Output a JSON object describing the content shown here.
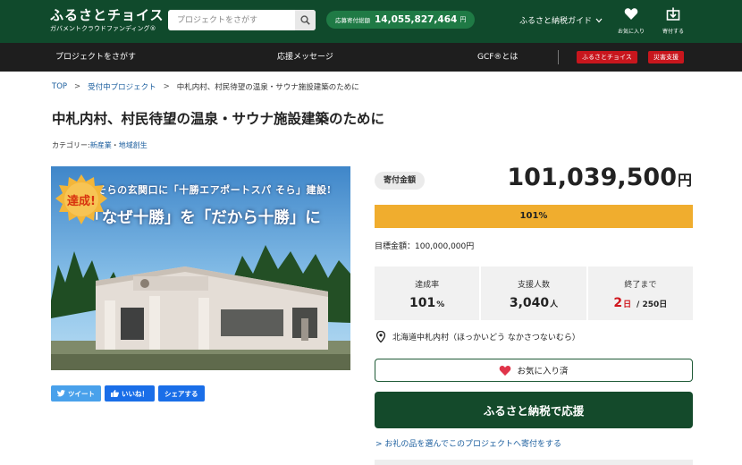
{
  "header": {
    "logo_text": "ふるさとチョイス",
    "logo_sub": "ガバメントクラウドファンディング®",
    "search_placeholder": "プロジェクトをさがす",
    "total_label": "応募寄付総額",
    "total_value": "14,055,827,464",
    "total_unit": "円",
    "guide_label": "ふるさと納税ガイド",
    "favorites_label": "お気に入り",
    "donations_label": "寄付する"
  },
  "nav": {
    "items": [
      "プロジェクトをさがす",
      "応援メッセージ",
      "GCF®とは"
    ],
    "badges": [
      "ふるさとチョイス",
      "災害支援"
    ]
  },
  "breadcrumb": {
    "top": "TOP",
    "accepting": "受付中プロジェクト",
    "current": "中札内村、村民待望の温泉・サウナ施設建築のために"
  },
  "project": {
    "title": "中札内村、村民待望の温泉・サウナ施設建築のために",
    "category_label": "カテゴリー:",
    "category_1": "新産業",
    "category_sep": "・",
    "category_2": "地域創生",
    "image_caption_1": "そらの玄関口に「十勝エアポートスパ そら」建設!",
    "image_caption_2": "「なぜ十勝」を「だから十勝」に",
    "achieved_badge": "達成!"
  },
  "share": {
    "tweet": "ツイート",
    "like": "いいね！",
    "share": "シェアする"
  },
  "funding": {
    "amount_label": "寄付金額",
    "amount_value": "101,039,500",
    "amount_unit": "円",
    "progress_text": "101%",
    "progress_fraction": 1.0,
    "target_text": "目標金額：100,000,000円",
    "stats": [
      {
        "label": "達成率",
        "value": "101",
        "unit": "%"
      },
      {
        "label": "支援人数",
        "value": "3,040",
        "unit": "人"
      },
      {
        "label": "終了まで",
        "value": "2",
        "unit": "日",
        "suffix": "/ 250日"
      }
    ],
    "location": "北海道中札内村（ほっかいどう なかさつないむら）",
    "favorite_button": "お気に入り済",
    "donate_button": "ふるさと納税で応援",
    "gift_link": "> お礼の品を選んでこのプロジェクトへ寄付をする"
  },
  "colors": {
    "header_green": "#104a2c",
    "nav_dark": "#1e1e1e",
    "progress_orange": "#f0ad2e",
    "accent_red": "#c8161d",
    "link_blue": "#1b5e9e"
  }
}
